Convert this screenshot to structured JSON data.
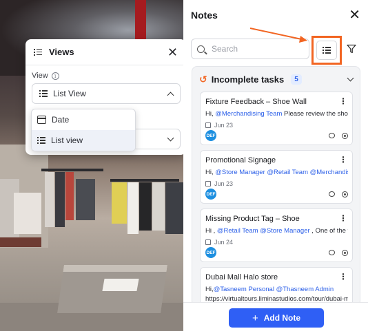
{
  "views_panel": {
    "title": "Views",
    "view_label": "View",
    "selected_view": "List View",
    "options": [
      {
        "label": "Date",
        "icon": "calendar-icon"
      },
      {
        "label": "List view",
        "icon": "list-icon"
      }
    ]
  },
  "notes": {
    "title": "Notes",
    "search_placeholder": "Search",
    "section": {
      "label": "Incomplete tasks",
      "count": "5"
    },
    "cards": [
      {
        "title": "Fixture Feedback – Shoe Wall",
        "body": [
          {
            "t": "Hi, ",
            "m": false
          },
          {
            "t": "@Merchandising Team",
            "m": true
          },
          {
            "t": " Please review the shoe wall",
            "m": false
          }
        ],
        "date": "Jun 23",
        "avatar": "DEF"
      },
      {
        "title": "Promotional Signage",
        "body": [
          {
            "t": "Hi, ",
            "m": false
          },
          {
            "t": "@Store Manager",
            "m": true
          },
          {
            "t": " ",
            "m": false
          },
          {
            "t": "@Retail Team",
            "m": true
          },
          {
            "t": " ",
            "m": false
          },
          {
            "t": "@Merchandising Te",
            "m": true
          }
        ],
        "date": "Jun 23",
        "avatar": "DEF"
      },
      {
        "title": "Missing Product Tag – Shoe",
        "body": [
          {
            "t": "Hi , ",
            "m": false
          },
          {
            "t": "@Retail Team",
            "m": true
          },
          {
            "t": " ",
            "m": false
          },
          {
            "t": "@Store Manager",
            "m": true
          },
          {
            "t": " , One of the tags fo",
            "m": false
          }
        ],
        "date": "Jun 24",
        "avatar": "DEF"
      },
      {
        "title": "Dubai Mall Halo store",
        "body": [
          {
            "t": "Hi,",
            "m": false
          },
          {
            "t": "@Tasneem Personal",
            "m": true
          },
          {
            "t": " ",
            "m": false
          },
          {
            "t": "@Thasneem Admin",
            "m": true
          }
        ],
        "body2": "https://virtualtours.liminastudios.com/tour/dubai-mall-ha",
        "date": "",
        "avatar": ""
      }
    ],
    "add_note_label": "Add Note"
  },
  "colors": {
    "accent": "#2f5ff5",
    "highlight": "#f26522",
    "mention": "#2b5fe8",
    "avatar": "#1d8fe0"
  }
}
